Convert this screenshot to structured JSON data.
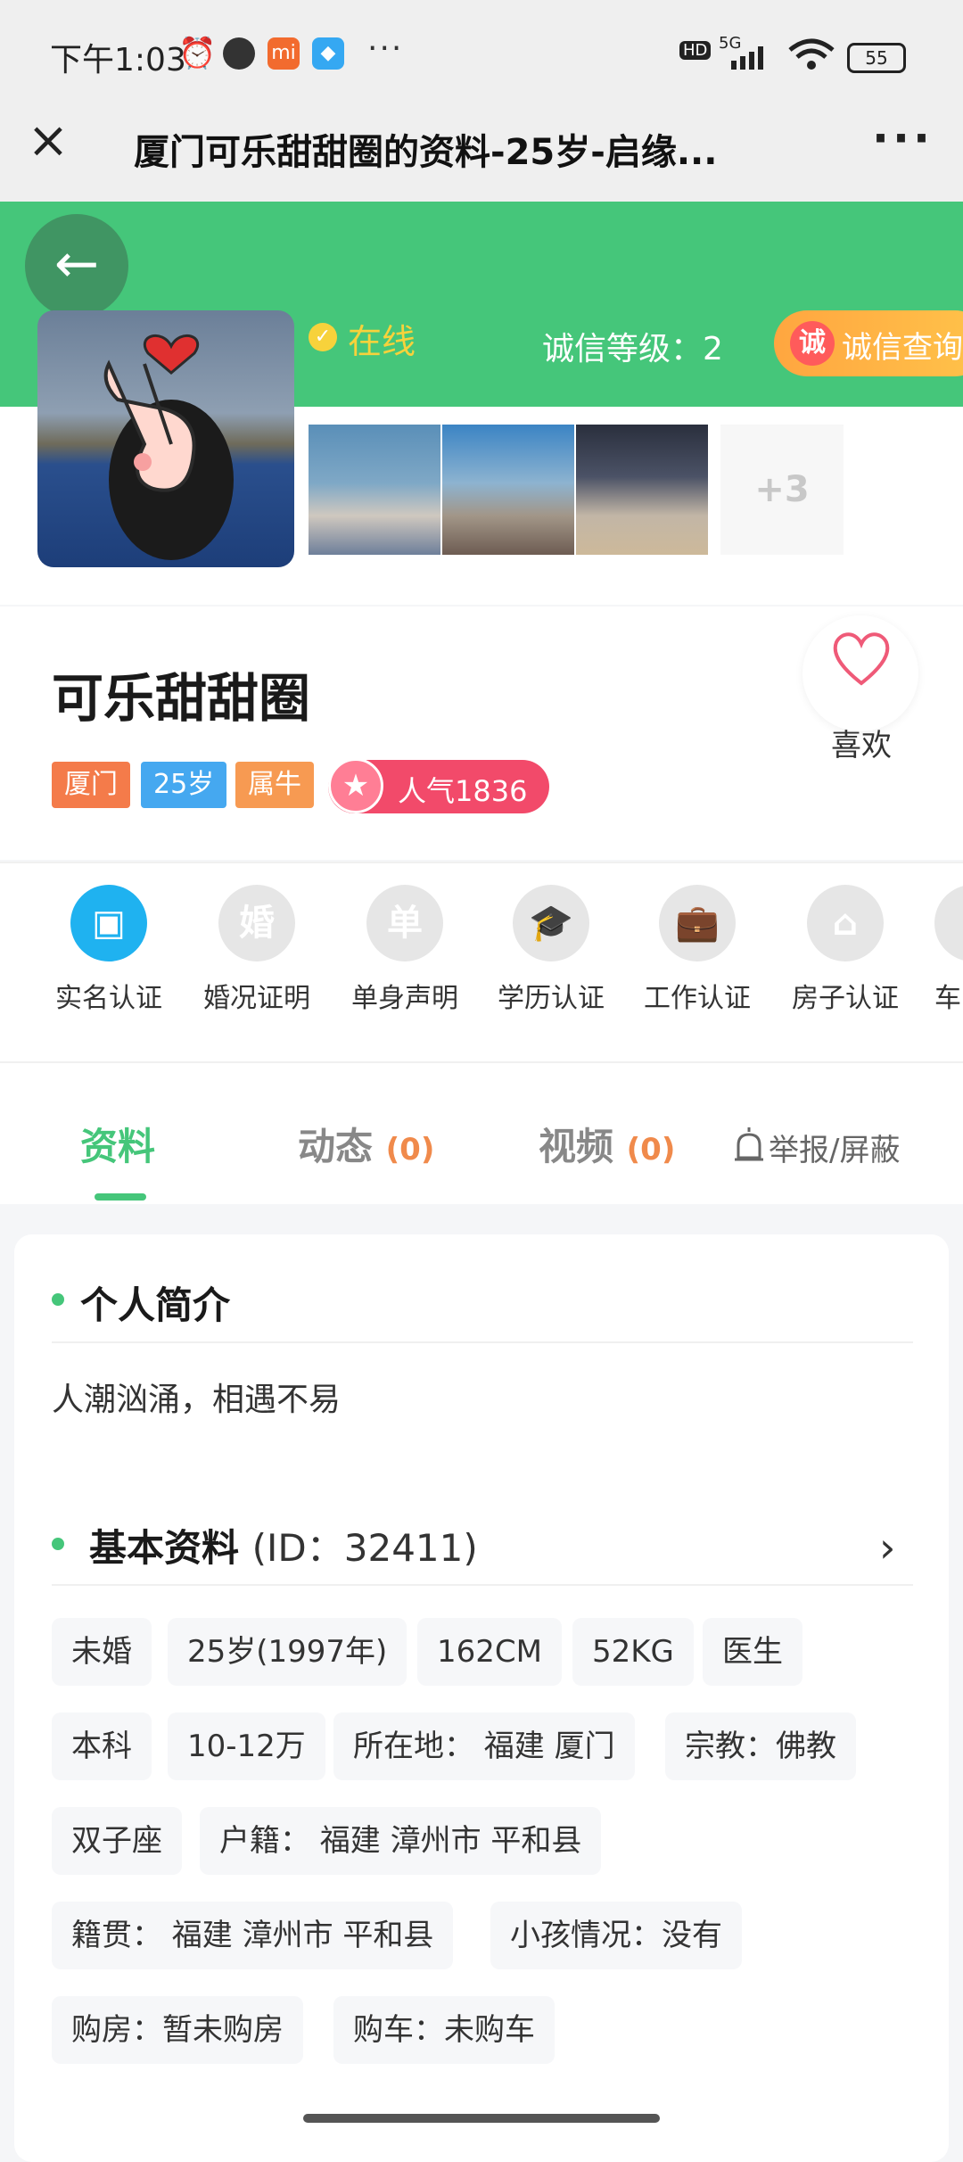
{
  "status_bar": {
    "time": "下午1:03",
    "more": "···",
    "network": "5G",
    "hd": "HD",
    "battery": "55"
  },
  "title_bar": {
    "title": "厦门可乐甜甜圈的资料-25岁-启缘..."
  },
  "header": {
    "online_label": "在线",
    "credit_level": "诚信等级：2",
    "credit_badge": "诚",
    "credit_query": "诚信查询",
    "more_photos": "+3"
  },
  "profile": {
    "name": "可乐甜甜圈",
    "like_label": "喜欢",
    "tags": [
      "厦门",
      "25岁",
      "属牛"
    ],
    "popularity": "人气1836"
  },
  "certifications": [
    {
      "label": "实名认证",
      "icon": "id-card-icon",
      "glyph": "▣",
      "active": true
    },
    {
      "label": "婚况证明",
      "icon": "marriage-icon",
      "glyph": "婚",
      "active": false
    },
    {
      "label": "单身声明",
      "icon": "single-icon",
      "glyph": "单",
      "active": false
    },
    {
      "label": "学历认证",
      "icon": "graduation-cap-icon",
      "glyph": "🎓",
      "active": false
    },
    {
      "label": "工作认证",
      "icon": "briefcase-icon",
      "glyph": "💼",
      "active": false
    },
    {
      "label": "房子认证",
      "icon": "house-icon",
      "glyph": "⌂",
      "active": false
    },
    {
      "label": "车",
      "icon": "car-icon",
      "glyph": "",
      "active": false
    }
  ],
  "tabs": [
    {
      "label": "资料",
      "count": ""
    },
    {
      "label": "动态",
      "count": "(0)"
    },
    {
      "label": "视频",
      "count": "(0)"
    }
  ],
  "report_label": "举报/屏蔽",
  "intro": {
    "title": "个人简介",
    "text": "人潮汹涌，相遇不易"
  },
  "basic": {
    "title": "基本资料",
    "id_text": "(ID：32411)",
    "rows": [
      [
        "未婚",
        "25岁(1997年)",
        "162CM",
        "52KG",
        "医生"
      ],
      [
        "本科",
        "10-12万",
        "所在地：  福建 厦门",
        "宗教：佛教"
      ],
      [
        "双子座",
        "户籍：  福建 漳州市 平和县"
      ],
      [
        "籍贯：  福建 漳州市 平和县",
        "小孩情况：没有"
      ],
      [
        "购房：暂未购房",
        "购车：未购车"
      ]
    ]
  },
  "colors": {
    "brand_green": "#45c67a",
    "tag_city": "#f47b4a",
    "tag_age": "#45a8f0",
    "tag_zodiac": "#f79a52",
    "popularity": "#f24a6a",
    "active_cert": "#1fb2f0"
  }
}
